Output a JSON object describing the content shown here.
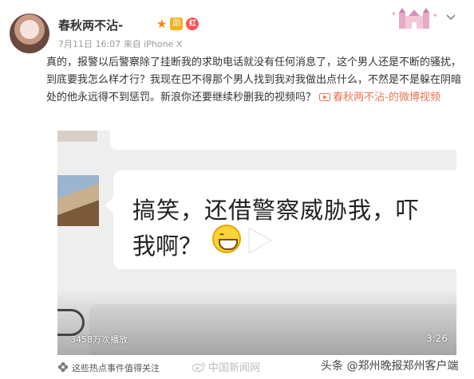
{
  "post": {
    "username": "春秋两不沾-",
    "meta": "7月11日 16:07 来自 iPhone X",
    "text": "真的，报警以后警察除了挂断我的求助电话就没有任何消息了，这个男人还是不断的骚扰，到底要我怎么样才行？我现在巴不得那个男人找到我对我做出点什么，不然是不是躲在阴暗处的他永远得不到惩罚。新浪你还要继续秒删我的视频吗？",
    "video_link": "春秋两不沾-的微博视频"
  },
  "badges": {
    "star": "★",
    "medal": "勋",
    "v": "红"
  },
  "video": {
    "line1": "搞笑，还借警察威胁我，吓",
    "line2": "我啊？",
    "views": "3458万次播放",
    "duration": "3:26"
  },
  "footer": {
    "hot_topic": "这些热点事件值得关注"
  },
  "watermarks": {
    "left": "中国新闻网",
    "right": "头条 @郑州晚报郑州客户端"
  },
  "colors": {
    "link": "#eb7350",
    "star": "#ff8200"
  },
  "icons": {
    "video_link": "play-icon",
    "footer": "flower-icon",
    "menu": "chevron-down-icon"
  }
}
